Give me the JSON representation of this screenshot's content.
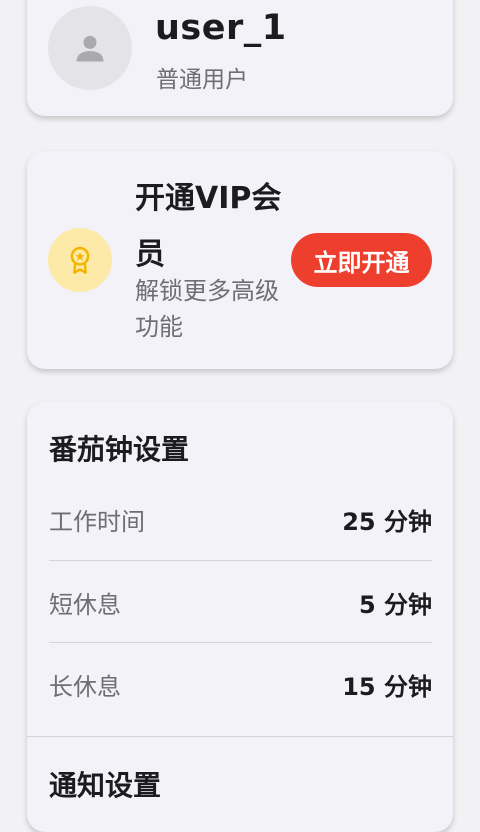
{
  "profile": {
    "username": "user_1",
    "level": "普通用户",
    "avatar_icon": "person-icon"
  },
  "vip": {
    "title": "开通VIP会员",
    "description": "解锁更多高级功能",
    "button_label": "立即开通",
    "icon": "medal-icon",
    "accent_color": "#ee3f2e",
    "icon_bg_color": "#fdeaa9",
    "icon_color": "#f5b400"
  },
  "pomodoro": {
    "title": "番茄钟设置",
    "rows": [
      {
        "label": "工作时间",
        "value": "25 分钟"
      },
      {
        "label": "短休息",
        "value": "5 分钟"
      },
      {
        "label": "长休息",
        "value": "15 分钟"
      }
    ]
  },
  "notifications": {
    "title": "通知设置"
  }
}
